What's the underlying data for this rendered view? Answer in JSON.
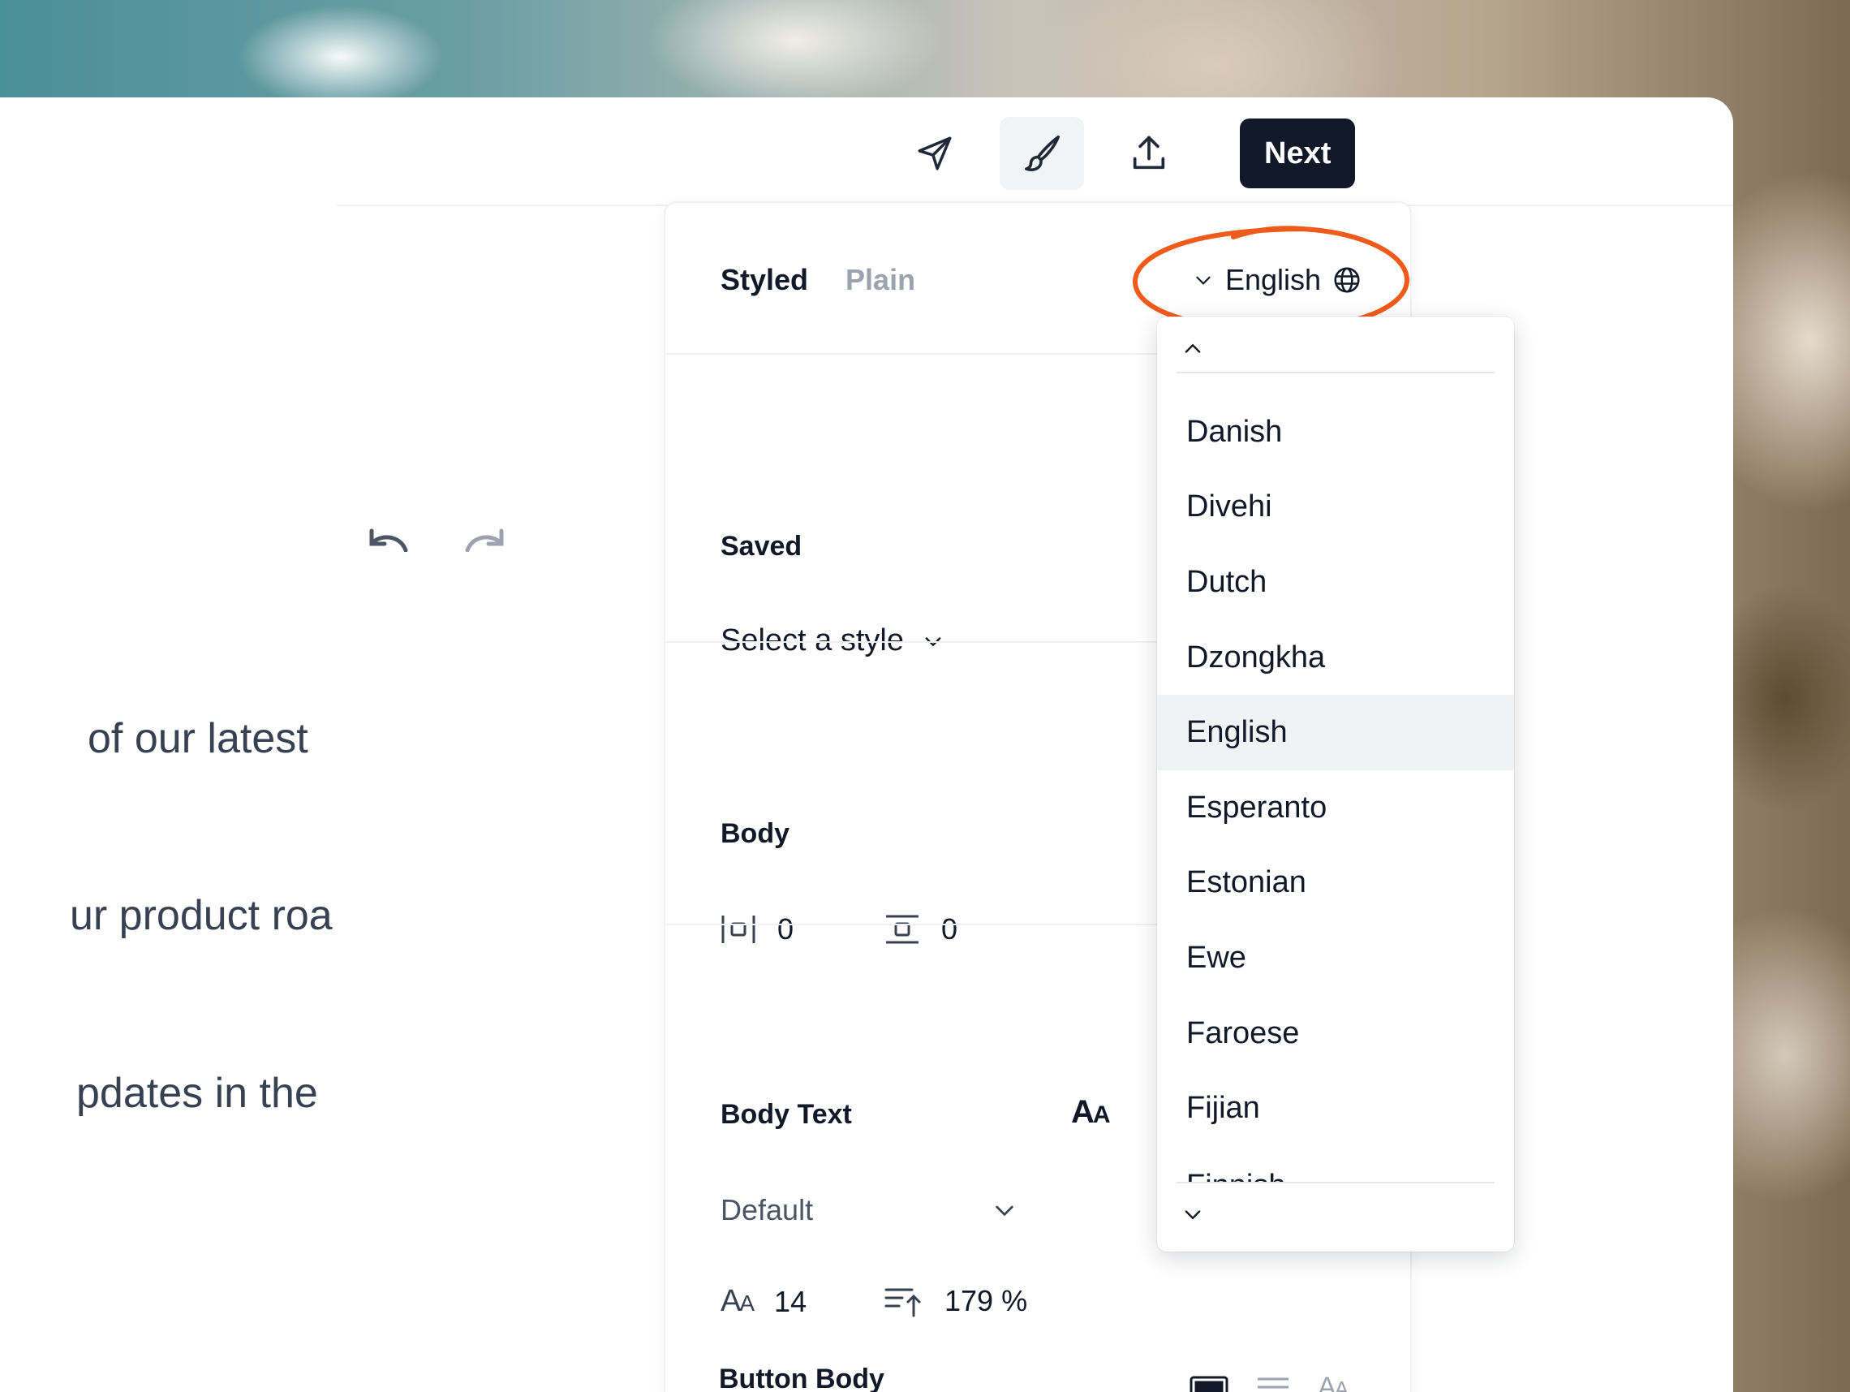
{
  "toolbar": {
    "send_icon": "send-icon",
    "brush_icon": "paintbrush-icon",
    "upload_icon": "upload-icon",
    "next_label": "Next"
  },
  "canvas": {
    "line1": "of our latest",
    "line2": "ur product roa",
    "line3": "pdates in the"
  },
  "panel": {
    "tabs": {
      "styled": "Styled",
      "plain": "Plain"
    },
    "language": {
      "current": "English"
    },
    "saved": {
      "title": "Saved",
      "select_placeholder": "Select a style"
    },
    "body": {
      "title": "Body",
      "horizontal_padding": "0",
      "vertical_padding": "0"
    },
    "body_text": {
      "title": "Body Text",
      "font_select": "Default",
      "font_size": "14",
      "line_height": "179 %",
      "case_icon_label": "AA"
    },
    "button_body": {
      "title": "Button Body"
    }
  },
  "language_dropdown": {
    "items": [
      "Danish",
      "Divehi",
      "Dutch",
      "Dzongkha",
      "English",
      "Esperanto",
      "Estonian",
      "Ewe",
      "Faroese",
      "Fijian"
    ],
    "selected": "English",
    "partial_bottom": "Finnish"
  },
  "colors": {
    "primary_dark": "#111827",
    "muted": "#9ca3af",
    "annotation": "#f05a1a",
    "selected_bg": "#f1f2f4"
  }
}
